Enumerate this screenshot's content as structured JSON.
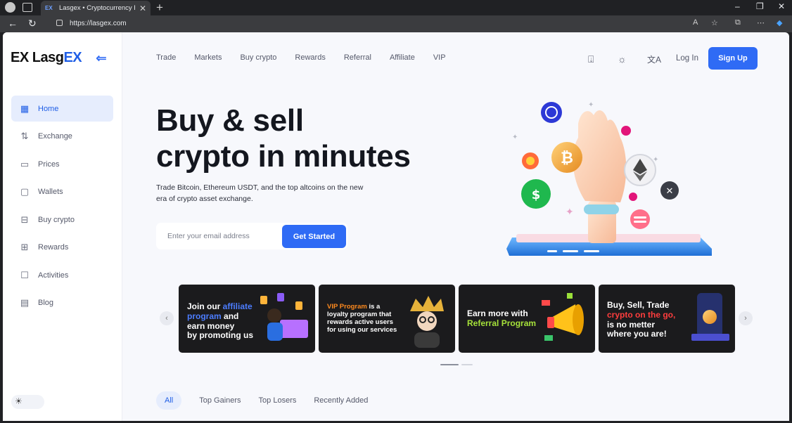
{
  "browser": {
    "tab_title": "Lasgex • Cryptocurrency Exchange",
    "favicon": "EX",
    "url": "https://lasgex.com",
    "new_tab": "+",
    "close_tab": "✕"
  },
  "brand": {
    "logo_mark": "EX",
    "logo_word": "Lasg",
    "logo_word_accent": "EX"
  },
  "sidebar": {
    "items": [
      {
        "label": "Home",
        "icon": "grid-icon",
        "active": true
      },
      {
        "label": "Exchange",
        "icon": "exchange-icon"
      },
      {
        "label": "Prices",
        "icon": "prices-icon"
      },
      {
        "label": "Wallets",
        "icon": "wallet-icon"
      },
      {
        "label": "Buy crypto",
        "icon": "buy-crypto-icon"
      },
      {
        "label": "Rewards",
        "icon": "gift-icon"
      },
      {
        "label": "Activities",
        "icon": "activity-icon"
      },
      {
        "label": "Blog",
        "icon": "blog-icon"
      }
    ]
  },
  "topnav": {
    "items": [
      "Trade",
      "Markets",
      "Buy crypto",
      "Rewards",
      "Referral",
      "Affiliate",
      "VIP"
    ],
    "login": "Log In",
    "signup": "Sign Up"
  },
  "hero": {
    "title_line1": "Buy & sell",
    "title_line2": "crypto in minutes",
    "subtitle": "Trade Bitcoin, Ethereum USDT, and the top altcoins on the new era of crypto asset exchange.",
    "email_placeholder": "Enter your email address",
    "cta": "Get Started"
  },
  "carousel": {
    "cards": [
      {
        "l1": "Join our ",
        "l1b": "affiliate",
        "l2a": "program",
        "l2b": " and",
        "l3": "earn money",
        "l4": "by promoting us"
      },
      {
        "l1a": "VIP Program",
        "l1b": " is a",
        "l2": "loyalty program that",
        "l3": "rewards active users",
        "l4": "for using our services"
      },
      {
        "l1": "Earn more with",
        "l2": "Referral Program"
      },
      {
        "l1": "Buy, Sell, Trade",
        "l2": "crypto on the go,",
        "l3": "is no metter",
        "l4": "where you are!"
      }
    ],
    "active_slide": 1,
    "slide_count": 2
  },
  "filters": {
    "items": [
      "All",
      "Top Gainers",
      "Top Losers",
      "Recently Added"
    ],
    "active": "All"
  },
  "colors": {
    "primary": "#2f6bf5",
    "active_bg": "#e6edfd",
    "page_bg": "#f7f8fc"
  }
}
